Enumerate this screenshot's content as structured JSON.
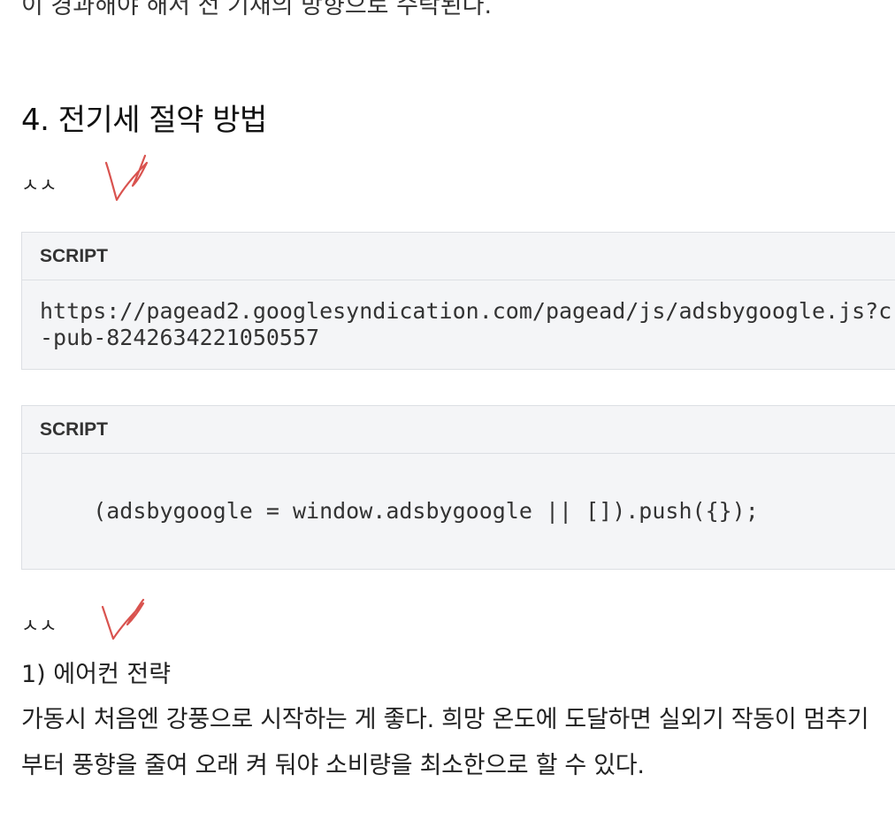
{
  "article": {
    "cut_off_line": "이 경과해야 해서 전 기재의 방향으로 수락된다.",
    "heading": "4. 전기세 절약 방법",
    "memo_1": "ㅅㅅ",
    "code_blocks": [
      {
        "label": "SCRIPT",
        "lines": [
          "https://pagead2.googlesyndication.com/pagead/js/adsbygoogle.js?c",
          "-pub-8242634221050557"
        ]
      },
      {
        "label": "SCRIPT",
        "lines": [
          "    (adsbygoogle = window.adsbygoogle || []).push({});"
        ]
      }
    ],
    "memo_2": "ㅅㅅ",
    "subheading": "1) 에어컨 전략",
    "paragraph_lines": [
      "가동시 처음엔 강풍으로 시작하는 게 좋다. 희망 온도에 도달하면 실외기 작동이 멈추기",
      "부터 풍향을 줄여 오래 켜 둬야 소비량을 최소한으로 할 수 있다."
    ]
  },
  "colors": {
    "check_mark": "#d9534f",
    "code_background": "#f4f5f7",
    "code_border": "#dcdfe3"
  },
  "icons": [
    "check-mark-icon"
  ]
}
